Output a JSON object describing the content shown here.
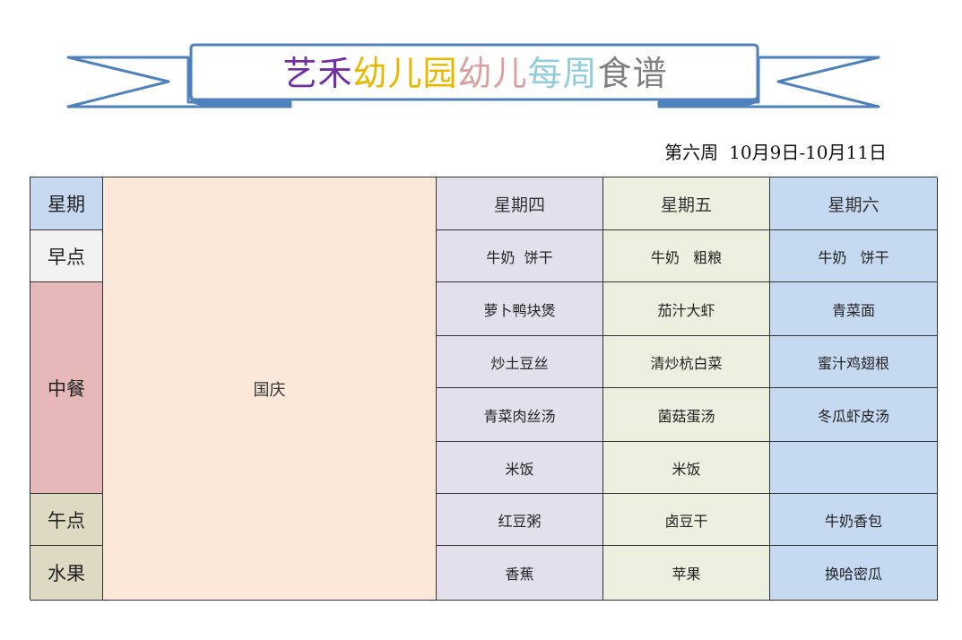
{
  "title": {
    "segments": [
      {
        "text": "艺禾",
        "color": "#7030a0"
      },
      {
        "text": "幼儿园",
        "color": "#e8b800"
      },
      {
        "text": "幼儿",
        "color": "#d9a0a0"
      },
      {
        "text": "每周",
        "color": "#92cddc"
      },
      {
        "text": "食谱",
        "color": "#7f7f7f"
      }
    ],
    "ribbon_color": "#4f81bd"
  },
  "week": {
    "label": "第六周",
    "range": "10月9日-10月11日"
  },
  "menu": {
    "corner": "星期",
    "holiday": "国庆",
    "days": [
      "星期四",
      "星期五",
      "星期六"
    ],
    "meals": {
      "breakfast": "早点",
      "lunch": "中餐",
      "snack": "午点",
      "fruit": "水果"
    },
    "thursday": {
      "breakfast": "牛奶  饼干",
      "lunch": [
        "萝卜鸭块煲",
        "炒土豆丝",
        "青菜肉丝汤",
        "米饭"
      ],
      "snack": "红豆粥",
      "fruit": "香蕉"
    },
    "friday": {
      "breakfast": "牛奶   粗粮",
      "lunch": [
        "茄汁大虾",
        "清炒杭白菜",
        "菌菇蛋汤",
        "米饭"
      ],
      "snack": "卤豆干",
      "fruit": "苹果"
    },
    "saturday": {
      "breakfast": "牛奶   饼干",
      "lunch": [
        "青菜面",
        "蜜汁鸡翅根",
        "冬瓜虾皮汤",
        ""
      ],
      "snack": "牛奶香包",
      "fruit": "换哈密瓜"
    }
  }
}
